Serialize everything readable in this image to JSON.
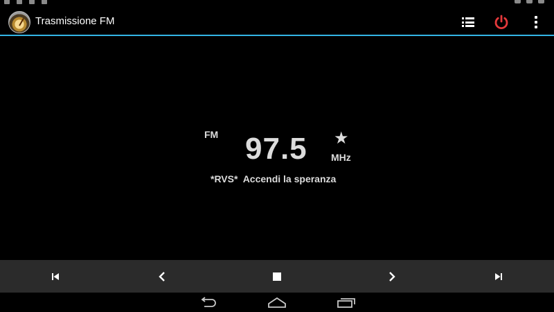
{
  "status_bar": {
    "clock": "",
    "left_icons": [
      "notification-icon",
      "notification-icon",
      "notification-icon",
      "notification-icon"
    ],
    "right_icons": [
      "headset-icon",
      "wifi-icon",
      "signal-icon"
    ]
  },
  "action_bar": {
    "app_icon": "radio-dial-icon",
    "title": "Trasmissione FM",
    "actions": [
      {
        "name": "station-list",
        "icon": "list-icon"
      },
      {
        "name": "power",
        "icon": "power-icon"
      },
      {
        "name": "overflow-menu",
        "icon": "more-vert-icon"
      }
    ]
  },
  "tuner": {
    "band": "FM",
    "frequency": "97.5",
    "unit": "MHz",
    "favorite_icon": "star-icon",
    "rds": "*RVS*  Accendi la speranza"
  },
  "transport": {
    "buttons": [
      "skip-previous-icon",
      "chevron-left-icon",
      "stop-icon",
      "chevron-right-icon",
      "skip-next-icon"
    ]
  },
  "nav_bar": {
    "buttons": [
      "back-icon",
      "home-icon",
      "recents-icon"
    ]
  },
  "colors": {
    "accent": "#33b5e5",
    "power": "#e5393b",
    "background": "#000000",
    "transport_bg": "#2b2b2b",
    "text": "#dcdcdc"
  }
}
